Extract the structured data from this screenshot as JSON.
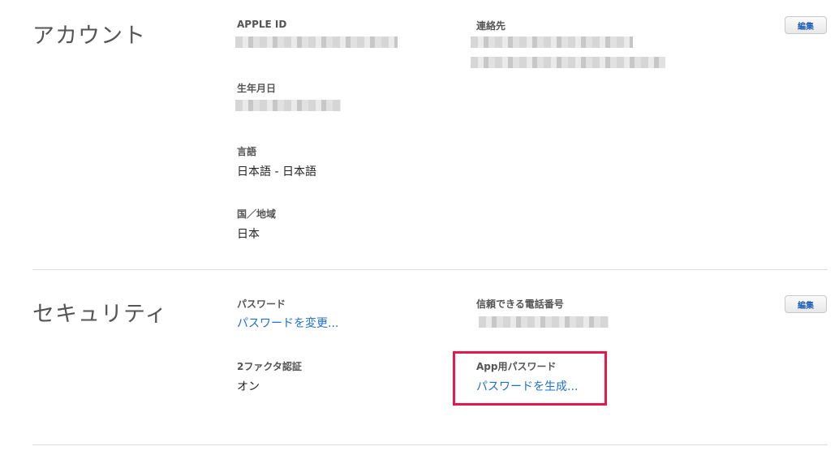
{
  "account": {
    "title": "アカウント",
    "edit_label": "編集",
    "apple_id": {
      "label": "APPLE ID"
    },
    "contact": {
      "label": "連絡先"
    },
    "birthday": {
      "label": "生年月日"
    },
    "language": {
      "label": "言語",
      "value": "日本語 - 日本語"
    },
    "region": {
      "label": "国／地域",
      "value": "日本"
    }
  },
  "security": {
    "title": "セキュリティ",
    "edit_label": "編集",
    "password": {
      "label": "パスワード",
      "link": "パスワードを変更..."
    },
    "trusted_phone": {
      "label": "信頼できる電話番号"
    },
    "two_factor": {
      "label": "2ファクタ認証",
      "value": "オン"
    },
    "app_password": {
      "label": "App用パスワード",
      "link": "パスワードを生成..."
    }
  },
  "colors": {
    "link": "#1f6fd1",
    "highlight": "#e8194a"
  }
}
